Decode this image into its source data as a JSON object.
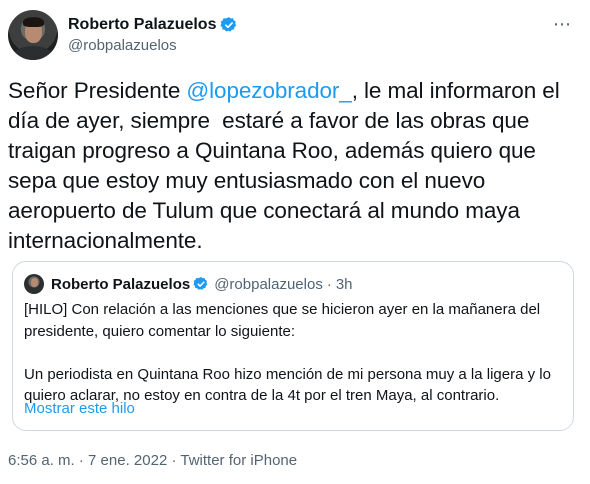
{
  "author": {
    "display_name": "Roberto Palazuelos",
    "handle": "@robpalazuelos"
  },
  "more_icon": "⋯",
  "tweet": {
    "before_mention": "Señor Presidente ",
    "mention": "@lopezobrador_",
    "after_mention": ", le mal informaron el día de ayer, siempre  estaré a favor de las obras que traigan progreso a Quintana Roo, además quiero que sepa que estoy muy entusiasmado con el nuevo aeropuerto de Tulum que conectará al mundo maya internacionalmente."
  },
  "quote": {
    "display_name": "Roberto Palazuelos",
    "handle": "@robpalazuelos",
    "separator": "·",
    "time": "3h",
    "text": "[HILO] Con relación a las menciones que se hicieron ayer en la mañanera del presidente, quiero comentar lo siguiente:\n\nUn periodista en Quintana Roo hizo mención de mi persona muy a la ligera y lo quiero aclarar, no estoy en contra de la 4t por el tren Maya, al contrario.",
    "show_thread": "Mostrar este hilo"
  },
  "meta": {
    "time": "6:56 a. m.",
    "date": "7 ene. 2022",
    "source": "Twitter for iPhone",
    "separator": "·"
  },
  "colors": {
    "accent": "#1d9bf0",
    "secondary_text": "#536471",
    "border": "#cfd9de"
  }
}
